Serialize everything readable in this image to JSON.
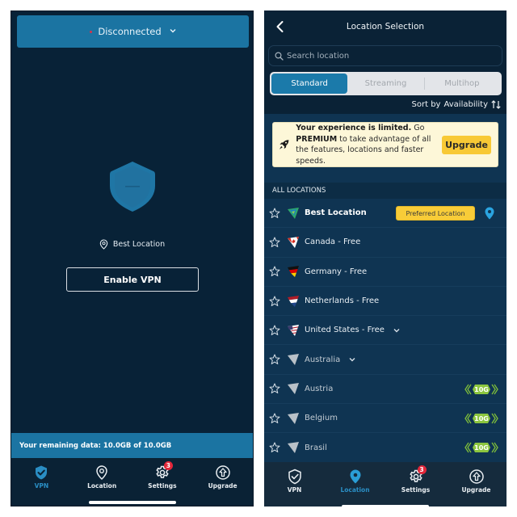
{
  "left_screen": {
    "status": {
      "label": "Disconnected",
      "dot_color": "#d9324a",
      "icon": "chevron-down-icon"
    },
    "shield": {
      "icon": "shield-disconnected-icon",
      "color": "#1b74a2"
    },
    "location": {
      "icon": "location-pin-icon",
      "label": "Best Location"
    },
    "enable_button": "Enable VPN",
    "remaining_data": "Your remaining data: 10.0GB of 10.0GB",
    "tabbar": [
      {
        "label": "VPN",
        "icon": "shield-check-icon",
        "active": true
      },
      {
        "label": "Location",
        "icon": "location-pin-icon",
        "active": false
      },
      {
        "label": "Settings",
        "icon": "gear-icon",
        "active": false,
        "badge": "3"
      },
      {
        "label": "Upgrade",
        "icon": "upgrade-arrow-icon",
        "active": false
      }
    ]
  },
  "right_screen": {
    "header": {
      "title": "Location Selection",
      "back_icon": "chevron-left-icon"
    },
    "search": {
      "placeholder": "Search location",
      "value": "",
      "icon": "search-icon"
    },
    "segments": [
      {
        "label": "Standard",
        "active": true
      },
      {
        "label": "Streaming",
        "active": false
      },
      {
        "label": "Multihop",
        "active": false
      }
    ],
    "sort": {
      "label": "Sort by",
      "value": "Availability",
      "icon": "sort-arrows-icon"
    },
    "promo": {
      "icon": "rocket-icon",
      "bold_lead": "Your experience is limited.",
      "text_1": " Go ",
      "bold_premium": "PREMIUM",
      "text_2": " to take advantage of all the features, locations and faster speeds.",
      "button": "Upgrade"
    },
    "section_label": "ALL LOCATIONS",
    "locations": [
      {
        "name": "Best Location",
        "flag": "best-location-flag",
        "badge": "Preferred Location",
        "trailing_icon": "location-pin-icon",
        "bold": true
      },
      {
        "name": "Canada - Free",
        "flag": "canada-flag"
      },
      {
        "name": "Germany - Free",
        "flag": "germany-flag"
      },
      {
        "name": "Netherlands - Free",
        "flag": "netherlands-flag"
      },
      {
        "name": "United States - Free",
        "flag": "united-states-flag",
        "expandable": true
      },
      {
        "name": "Australia",
        "flag": "locked-flag",
        "expandable": true,
        "dim": true
      },
      {
        "name": "Austria",
        "flag": "locked-flag",
        "speed": "10G",
        "dim": true
      },
      {
        "name": "Belgium",
        "flag": "locked-flag",
        "speed": "10G",
        "dim": true
      },
      {
        "name": "Brasil",
        "flag": "locked-flag",
        "speed": "10G",
        "dim": true
      }
    ],
    "tabbar": [
      {
        "label": "VPN",
        "icon": "shield-check-icon",
        "active": false
      },
      {
        "label": "Location",
        "icon": "location-pin-icon",
        "active": true
      },
      {
        "label": "Settings",
        "icon": "gear-icon",
        "active": false,
        "badge": "3"
      },
      {
        "label": "Upgrade",
        "icon": "upgrade-arrow-icon",
        "active": false
      }
    ]
  },
  "colors": {
    "accent": "#1b74a2",
    "active_tab": "#2a8ec4",
    "badge_red": "#e2273a",
    "upgrade_yellow": "#f8c935",
    "speed_green": "#8cc63f"
  }
}
